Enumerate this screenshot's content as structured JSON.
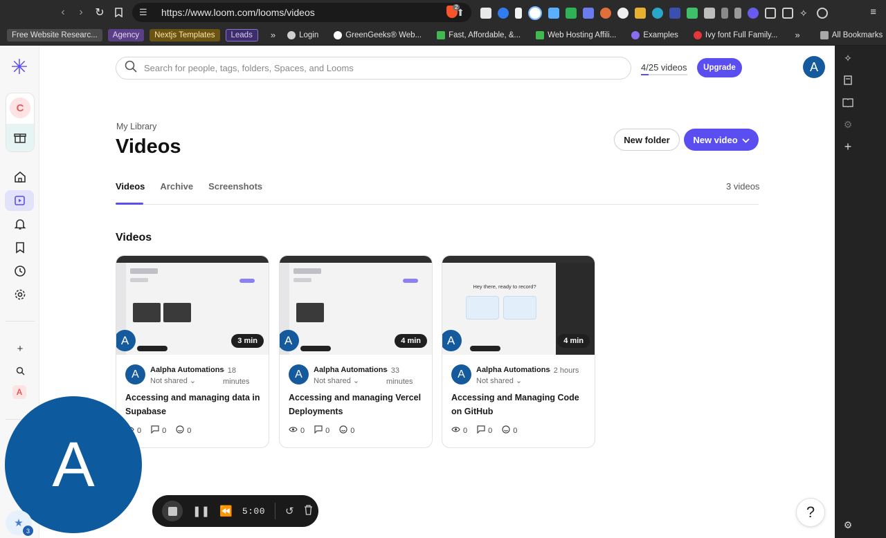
{
  "browser": {
    "url": "https://www.loom.com/looms/videos",
    "extension_badge": "2",
    "bookmarks": [
      {
        "label": "Free Website Researc...",
        "style": "tag"
      },
      {
        "label": "Agency",
        "style": "agency"
      },
      {
        "label": "Nextjs Templates",
        "style": "next"
      },
      {
        "label": "Leads",
        "style": "leads"
      }
    ],
    "bookmarks2": [
      {
        "label": "Login",
        "icon_color": "#cfcfcf"
      },
      {
        "label": "GreenGeeks® Web...",
        "icon_color": "#ffffff"
      },
      {
        "label": "Fast, Affordable, &...",
        "icon_color": "#3fb950"
      },
      {
        "label": "Web Hosting Affili...",
        "icon_color": "#3fb950"
      },
      {
        "label": "Examples",
        "icon_color": "#8a6cf0"
      },
      {
        "label": "Ivy font Full Family...",
        "icon_color": "#e5363a"
      }
    ],
    "all_bookmarks": "All Bookmarks"
  },
  "rail": {
    "workspace_initial": "C",
    "bottom_initial": "A"
  },
  "search": {
    "placeholder": "Search for people, tags, folders, Spaces, and Looms"
  },
  "header": {
    "quota": "4/25 videos",
    "quota_fraction": 0.16,
    "upgrade": "Upgrade",
    "avatar_initial": "A"
  },
  "page": {
    "breadcrumb": "My Library",
    "title": "Videos",
    "new_folder": "New folder",
    "new_video": "New video",
    "tabs": [
      "Videos",
      "Archive",
      "Screenshots"
    ],
    "count": "3 videos",
    "section_title": "Videos"
  },
  "videos": [
    {
      "duration": "3 min",
      "author": "Aalpha Automations",
      "ago": "18 minutes",
      "shared": "Not shared",
      "title": "Accessing and managing data in Supabase",
      "views": "0",
      "comments": "0",
      "reactions": "0",
      "initial": "A"
    },
    {
      "duration": "4 min",
      "author": "Aalpha Automations",
      "ago": "33 minutes",
      "shared": "Not shared",
      "title": "Accessing and managing Vercel Deployments",
      "views": "0",
      "comments": "0",
      "reactions": "0",
      "initial": "A"
    },
    {
      "duration": "4 min",
      "author": "Aalpha Automations",
      "ago": "2 hours",
      "shared": "Not shared",
      "title": "Accessing and Managing Code on GitHub",
      "views": "0",
      "comments": "0",
      "reactions": "0",
      "initial": "A",
      "thumb_text": "Hey there, ready to record?"
    }
  ],
  "recorder": {
    "camera_initial": "A",
    "time": "5:00",
    "badge": "3"
  },
  "help": "?",
  "colors": {
    "accent": "#5b4ef0",
    "avatar": "#155a9c"
  }
}
